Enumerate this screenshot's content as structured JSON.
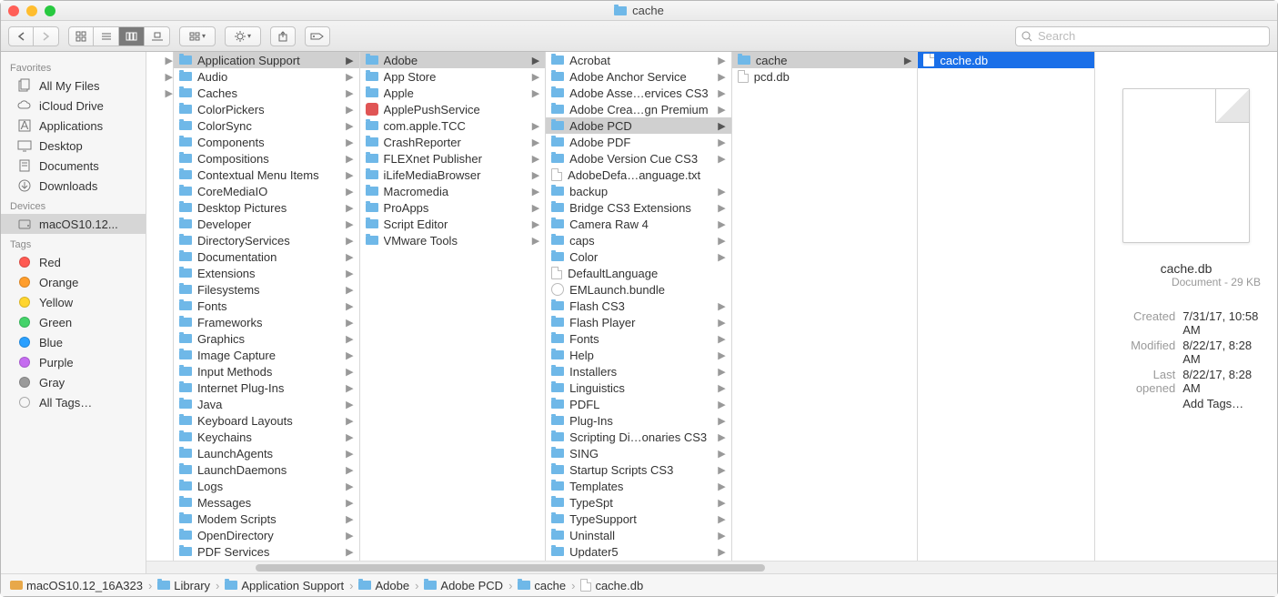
{
  "window": {
    "title": "cache"
  },
  "toolbar": {
    "search_placeholder": "Search"
  },
  "sidebar": {
    "sections": [
      {
        "label": "Favorites",
        "items": [
          {
            "label": "All My Files",
            "icon": "all-files"
          },
          {
            "label": "iCloud Drive",
            "icon": "cloud"
          },
          {
            "label": "Applications",
            "icon": "apps"
          },
          {
            "label": "Desktop",
            "icon": "desktop"
          },
          {
            "label": "Documents",
            "icon": "documents"
          },
          {
            "label": "Downloads",
            "icon": "downloads"
          }
        ]
      },
      {
        "label": "Devices",
        "items": [
          {
            "label": "macOS10.12...",
            "icon": "disk",
            "selected": true
          }
        ]
      },
      {
        "label": "Tags",
        "items": [
          {
            "label": "Red",
            "color": "#ff5a52"
          },
          {
            "label": "Orange",
            "color": "#ff9e2c"
          },
          {
            "label": "Yellow",
            "color": "#ffd52e"
          },
          {
            "label": "Green",
            "color": "#44d36a"
          },
          {
            "label": "Blue",
            "color": "#2aa0ff"
          },
          {
            "label": "Purple",
            "color": "#c56cf0"
          },
          {
            "label": "Gray",
            "color": "#9a9a9a"
          },
          {
            "label": "All Tags…",
            "color": null
          }
        ]
      }
    ]
  },
  "columns": {
    "col0": [
      {
        "chev": true
      },
      {
        "chev": true
      },
      {
        "chev": true
      }
    ],
    "col1": [
      {
        "label": "Application Support",
        "type": "folder",
        "selected": true,
        "chev": true
      },
      {
        "label": "Audio",
        "type": "folder",
        "chev": true
      },
      {
        "label": "Caches",
        "type": "folder",
        "chev": true
      },
      {
        "label": "ColorPickers",
        "type": "folder",
        "chev": true
      },
      {
        "label": "ColorSync",
        "type": "folder",
        "chev": true
      },
      {
        "label": "Components",
        "type": "folder",
        "chev": true
      },
      {
        "label": "Compositions",
        "type": "folder",
        "chev": true
      },
      {
        "label": "Contextual Menu Items",
        "type": "folder",
        "chev": true
      },
      {
        "label": "CoreMediaIO",
        "type": "folder",
        "chev": true
      },
      {
        "label": "Desktop Pictures",
        "type": "folder",
        "chev": true
      },
      {
        "label": "Developer",
        "type": "folder",
        "chev": true
      },
      {
        "label": "DirectoryServices",
        "type": "folder",
        "chev": true
      },
      {
        "label": "Documentation",
        "type": "folder",
        "chev": true
      },
      {
        "label": "Extensions",
        "type": "folder",
        "chev": true
      },
      {
        "label": "Filesystems",
        "type": "folder",
        "chev": true
      },
      {
        "label": "Fonts",
        "type": "folder",
        "chev": true
      },
      {
        "label": "Frameworks",
        "type": "folder",
        "chev": true
      },
      {
        "label": "Graphics",
        "type": "folder",
        "chev": true
      },
      {
        "label": "Image Capture",
        "type": "folder",
        "chev": true
      },
      {
        "label": "Input Methods",
        "type": "folder",
        "chev": true
      },
      {
        "label": "Internet Plug-Ins",
        "type": "folder",
        "chev": true
      },
      {
        "label": "Java",
        "type": "folder",
        "chev": true
      },
      {
        "label": "Keyboard Layouts",
        "type": "folder",
        "chev": true
      },
      {
        "label": "Keychains",
        "type": "folder",
        "chev": true
      },
      {
        "label": "LaunchAgents",
        "type": "folder",
        "chev": true
      },
      {
        "label": "LaunchDaemons",
        "type": "folder",
        "chev": true
      },
      {
        "label": "Logs",
        "type": "folder",
        "chev": true
      },
      {
        "label": "Messages",
        "type": "folder",
        "chev": true
      },
      {
        "label": "Modem Scripts",
        "type": "folder",
        "chev": true
      },
      {
        "label": "OpenDirectory",
        "type": "folder",
        "chev": true
      },
      {
        "label": "PDF Services",
        "type": "folder",
        "chev": true
      }
    ],
    "col2": [
      {
        "label": "Adobe",
        "type": "folder",
        "selected": true,
        "chev": true
      },
      {
        "label": "App Store",
        "type": "folder",
        "chev": true
      },
      {
        "label": "Apple",
        "type": "folder",
        "chev": true
      },
      {
        "label": "ApplePushService",
        "type": "app",
        "chev": false
      },
      {
        "label": "com.apple.TCC",
        "type": "folder",
        "chev": true
      },
      {
        "label": "CrashReporter",
        "type": "folder",
        "chev": true
      },
      {
        "label": "FLEXnet Publisher",
        "type": "folder",
        "chev": true
      },
      {
        "label": "iLifeMediaBrowser",
        "type": "folder",
        "chev": true
      },
      {
        "label": "Macromedia",
        "type": "folder",
        "chev": true
      },
      {
        "label": "ProApps",
        "type": "folder",
        "chev": true
      },
      {
        "label": "Script Editor",
        "type": "folder",
        "chev": true
      },
      {
        "label": "VMware Tools",
        "type": "folder",
        "chev": true
      }
    ],
    "col3": [
      {
        "label": "Acrobat",
        "type": "folder",
        "chev": true
      },
      {
        "label": "Adobe Anchor Service",
        "type": "folder",
        "chev": true
      },
      {
        "label": "Adobe Asse…ervices CS3",
        "type": "folder",
        "chev": true
      },
      {
        "label": "Adobe Crea…gn Premium",
        "type": "folder",
        "chev": true
      },
      {
        "label": "Adobe PCD",
        "type": "folder",
        "selected": true,
        "chev": true
      },
      {
        "label": "Adobe PDF",
        "type": "folder",
        "chev": true
      },
      {
        "label": "Adobe Version Cue CS3",
        "type": "folder",
        "chev": true
      },
      {
        "label": "AdobeDefa…anguage.txt",
        "type": "file",
        "chev": false
      },
      {
        "label": "backup",
        "type": "folder",
        "chev": true
      },
      {
        "label": "Bridge CS3 Extensions",
        "type": "folder",
        "chev": true
      },
      {
        "label": "Camera Raw 4",
        "type": "folder",
        "chev": true
      },
      {
        "label": "caps",
        "type": "folder",
        "chev": true
      },
      {
        "label": "Color",
        "type": "folder",
        "chev": true
      },
      {
        "label": "DefaultLanguage",
        "type": "file",
        "chev": false
      },
      {
        "label": "EMLaunch.bundle",
        "type": "bundle",
        "chev": false
      },
      {
        "label": "Flash CS3",
        "type": "folder",
        "chev": true
      },
      {
        "label": "Flash Player",
        "type": "folder",
        "chev": true
      },
      {
        "label": "Fonts",
        "type": "folder",
        "chev": true
      },
      {
        "label": "Help",
        "type": "folder",
        "chev": true
      },
      {
        "label": "Installers",
        "type": "folder",
        "chev": true
      },
      {
        "label": "Linguistics",
        "type": "folder",
        "chev": true
      },
      {
        "label": "PDFL",
        "type": "folder",
        "chev": true
      },
      {
        "label": "Plug-Ins",
        "type": "folder",
        "chev": true
      },
      {
        "label": "Scripting Di…onaries CS3",
        "type": "folder",
        "chev": true
      },
      {
        "label": "SING",
        "type": "folder",
        "chev": true
      },
      {
        "label": "Startup Scripts CS3",
        "type": "folder",
        "chev": true
      },
      {
        "label": "Templates",
        "type": "folder",
        "chev": true
      },
      {
        "label": "TypeSpt",
        "type": "folder",
        "chev": true
      },
      {
        "label": "TypeSupport",
        "type": "folder",
        "chev": true
      },
      {
        "label": "Uninstall",
        "type": "folder",
        "chev": true
      },
      {
        "label": "Updater5",
        "type": "folder",
        "chev": true
      }
    ],
    "col4": [
      {
        "label": "cache",
        "type": "folder",
        "selected": true,
        "chev": true
      },
      {
        "label": "pcd.db",
        "type": "file",
        "chev": false
      }
    ],
    "col5": [
      {
        "label": "cache.db",
        "type": "file",
        "focus": true,
        "chev": false
      }
    ]
  },
  "preview": {
    "name": "cache.db",
    "kind": "Document - 29 KB",
    "created_k": "Created",
    "created_v": "7/31/17, 10:58 AM",
    "modified_k": "Modified",
    "modified_v": "8/22/17, 8:28 AM",
    "opened_k": "Last opened",
    "opened_v": "8/22/17, 8:28 AM",
    "addtags": "Add Tags…"
  },
  "pathbar": [
    {
      "label": "macOS10.12_16A323",
      "icon": "disk"
    },
    {
      "label": "Library",
      "icon": "folder"
    },
    {
      "label": "Application Support",
      "icon": "folder"
    },
    {
      "label": "Adobe",
      "icon": "folder"
    },
    {
      "label": "Adobe PCD",
      "icon": "folder"
    },
    {
      "label": "cache",
      "icon": "folder"
    },
    {
      "label": "cache.db",
      "icon": "file"
    }
  ]
}
